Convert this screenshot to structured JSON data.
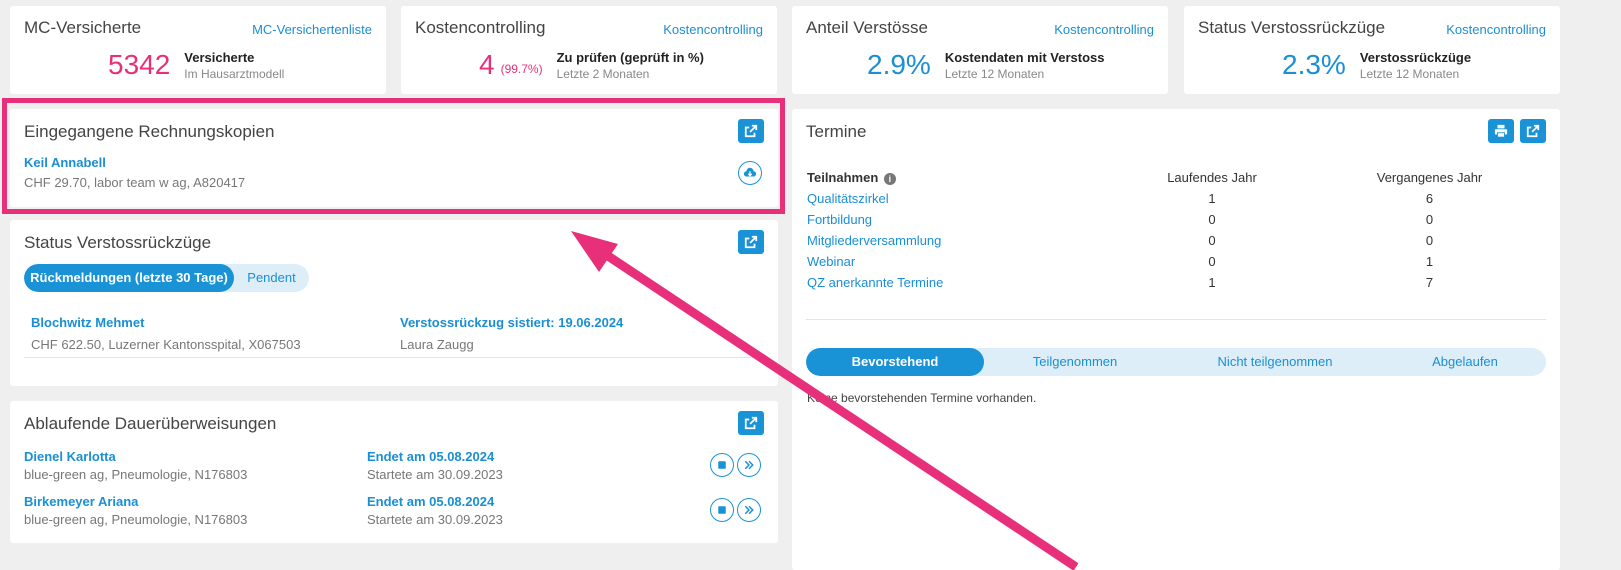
{
  "kpis": [
    {
      "title": "MC-Versicherte",
      "link": "MC-Versichertenliste",
      "value": "5342",
      "pct": "",
      "label": "Versicherte",
      "sub": "Im Hausarztmodell",
      "color": "#e8307a"
    },
    {
      "title": "Kostencontrolling",
      "link": "Kostencontrolling",
      "value": "4",
      "pct": "(99.7%)",
      "label": "Zu prüfen (geprüft in %)",
      "sub": "Letzte 2 Monaten",
      "color": "#e8307a"
    },
    {
      "title": "Anteil Verstösse",
      "link": "Kostencontrolling",
      "value": "2.9%",
      "pct": "",
      "label": "Kostendaten mit Verstoss",
      "sub": "Letzte 12 Monaten",
      "color": "#1a8fd4"
    },
    {
      "title": "Status Verstossrückzüge",
      "link": "Kostencontrolling",
      "value": "2.3%",
      "pct": "",
      "label": "Verstossrückzüge",
      "sub": "Letzte 12 Monaten",
      "color": "#1a8fd4"
    }
  ],
  "invoices": {
    "title": "Eingegangene Rechnungskopien",
    "item": {
      "name": "Keil Annabell",
      "detail": "CHF 29.70, labor team w ag, A820417"
    }
  },
  "withdrawals": {
    "title": "Status Verstossrückzüge",
    "tabs": [
      "Rückmeldungen (letzte 30 Tage)",
      "Pendent"
    ],
    "item": {
      "name": "Blochwitz Mehmet",
      "detail": "CHF 622.50, Luzerner Kantonsspital, X067503",
      "status": "Verstossrückzug sistiert: 19.06.2024",
      "person": "Laura Zaugg"
    }
  },
  "standing": {
    "title": "Ablaufende Dauerüberweisungen",
    "items": [
      {
        "name": "Dienel Karlotta",
        "detail": "blue-green ag, Pneumologie, N176803",
        "end": "Endet am 05.08.2024",
        "start": "Startete am 30.09.2023"
      },
      {
        "name": "Birkemeyer Ariana",
        "detail": "blue-green ag, Pneumologie, N176803",
        "end": "Endet am 05.08.2024",
        "start": "Startete am 30.09.2023"
      }
    ]
  },
  "termine": {
    "title": "Termine",
    "headers": {
      "label": "Teilnahmen",
      "current": "Laufendes Jahr",
      "previous": "Vergangenes Jahr"
    },
    "rows": [
      {
        "label": "Qualitätszirkel",
        "current": "1",
        "previous": "6"
      },
      {
        "label": "Fortbildung",
        "current": "0",
        "previous": "0"
      },
      {
        "label": "Mitgliederversammlung",
        "current": "0",
        "previous": "0"
      },
      {
        "label": "Webinar",
        "current": "0",
        "previous": "1"
      },
      {
        "label": "QZ anerkannte Termine",
        "current": "1",
        "previous": "7"
      }
    ],
    "tabs": [
      "Bevorstehend",
      "Teilgenommen",
      "Nicht teilgenommen",
      "Abgelaufen"
    ],
    "empty": "Keine bevorstehenden Termine vorhanden."
  },
  "colors": {
    "accent": "#1a93d6",
    "highlight": "#e8307a"
  }
}
